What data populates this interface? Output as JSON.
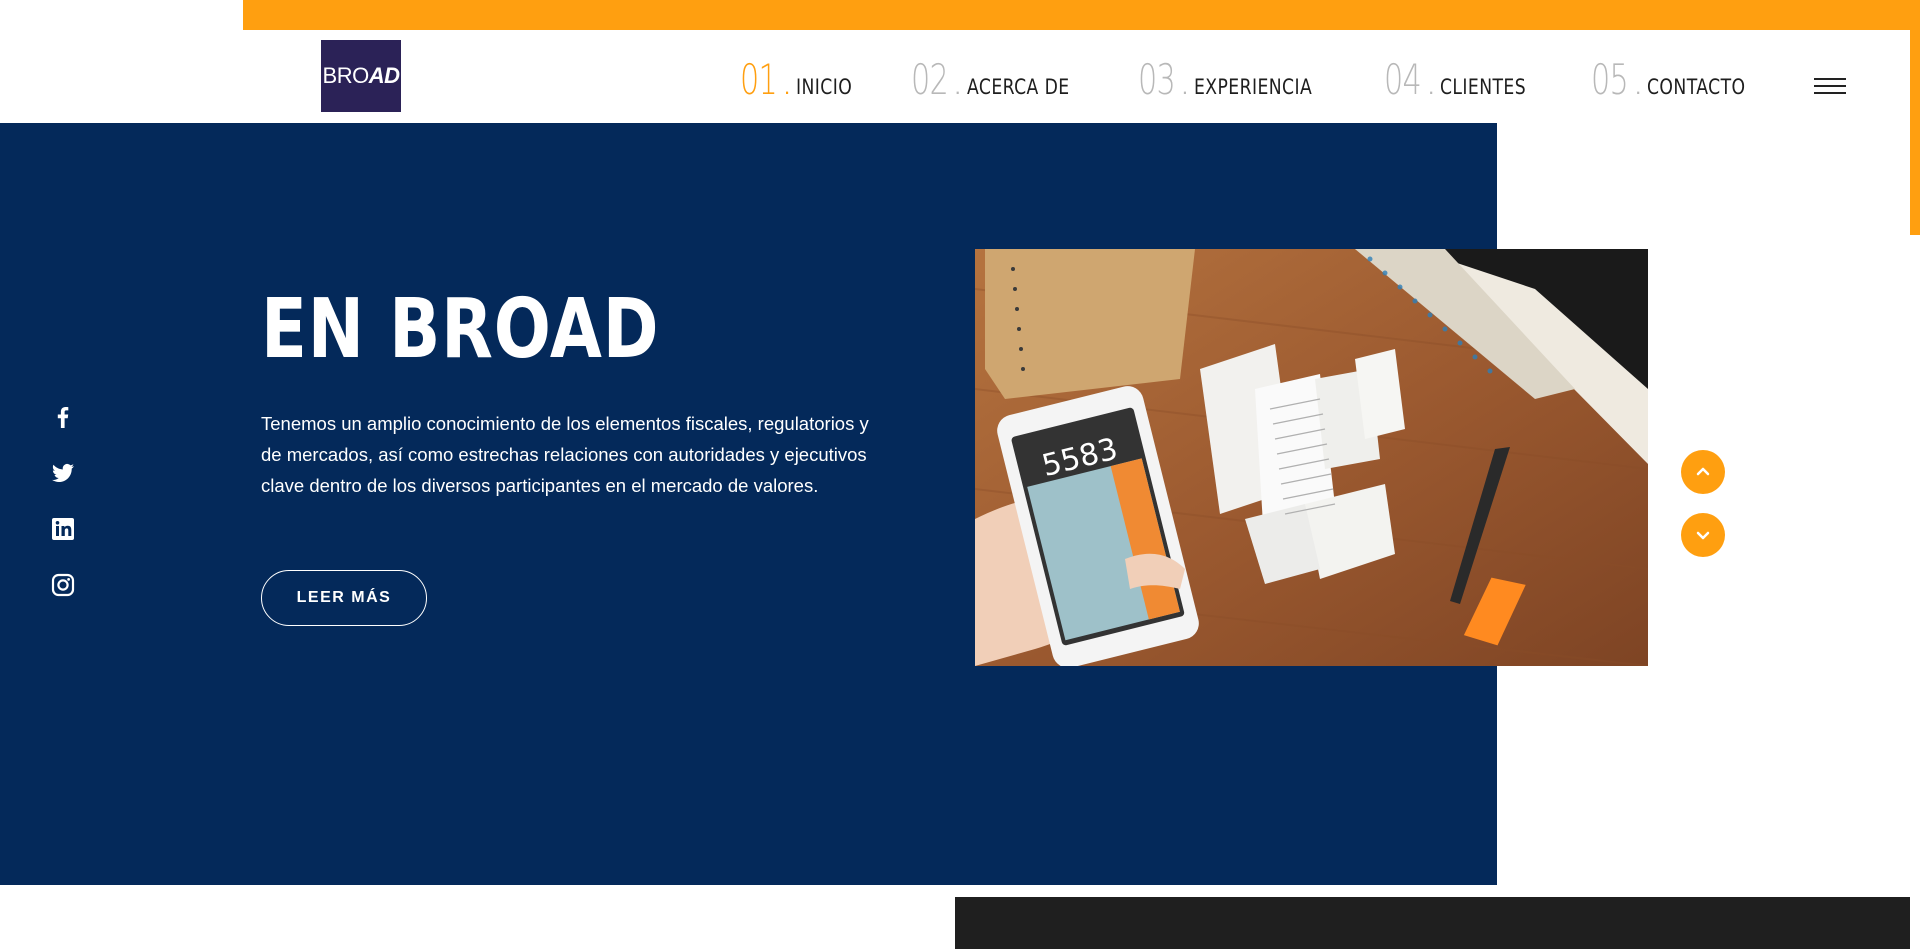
{
  "brand": {
    "logo_part1": "BRO",
    "logo_part2": "AD"
  },
  "nav": {
    "items": [
      {
        "num": "01",
        "label": "INICIO",
        "active": true
      },
      {
        "num": "02",
        "label": "ACERCA DE"
      },
      {
        "num": "03",
        "label": "EXPERIENCIA"
      },
      {
        "num": "04",
        "label": "CLIENTES"
      },
      {
        "num": "05",
        "label": "CONTACTO"
      }
    ],
    "menu_icon": "hamburger-menu-icon"
  },
  "hero": {
    "title": "EN BROAD",
    "text": "Tenemos un amplio conocimiento de los elementos fiscales, regulatorios y de mercados, así como estrechas relaciones con autoridades y ejecutivos clave dentro de los diversos participantes en el mercado de valores.",
    "cta": "LEER MÁS",
    "calculator_display": "5583"
  },
  "social": [
    "facebook-icon",
    "twitter-icon",
    "linkedin-icon",
    "instagram-icon"
  ],
  "slider_controls": [
    "chevron-up-icon",
    "chevron-down-icon"
  ],
  "colors": {
    "accent": "#ff9f10",
    "hero_bg": "#04295a",
    "logo_bg": "#2b2257",
    "dark": "#1f1f1f"
  }
}
